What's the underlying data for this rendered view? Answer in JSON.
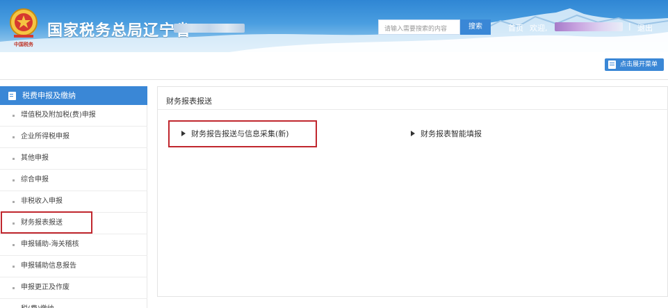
{
  "header": {
    "site_title": "国家税务总局辽宁省",
    "emblem_text": "中国税务",
    "search_placeholder": "请输入需要搜索的内容",
    "search_button": "搜索",
    "home_link": "首页",
    "welcome_text": "欢迎,",
    "separator": "|",
    "logout_link": "退出"
  },
  "toolbar": {
    "expand_menu": "点击展开菜单"
  },
  "sidebar": {
    "header": "税费申报及缴纳",
    "items": [
      {
        "label": "增值税及附加税(费)申报"
      },
      {
        "label": "企业所得税申报"
      },
      {
        "label": "其他申报"
      },
      {
        "label": "综合申报"
      },
      {
        "label": "非税收入申报"
      },
      {
        "label": "财务报表报送"
      },
      {
        "label": "申报辅助-海关稽核"
      },
      {
        "label": "申报辅助信息报告"
      },
      {
        "label": "申报更正及作废"
      },
      {
        "label": "税(费)缴纳"
      }
    ]
  },
  "main": {
    "title": "财务报表报送",
    "links": [
      {
        "label": "财务报告报送与信息采集(新)"
      },
      {
        "label": "财务报表智能填报"
      }
    ]
  },
  "colors": {
    "primary": "#3a87d6",
    "highlight": "#c0262d"
  }
}
